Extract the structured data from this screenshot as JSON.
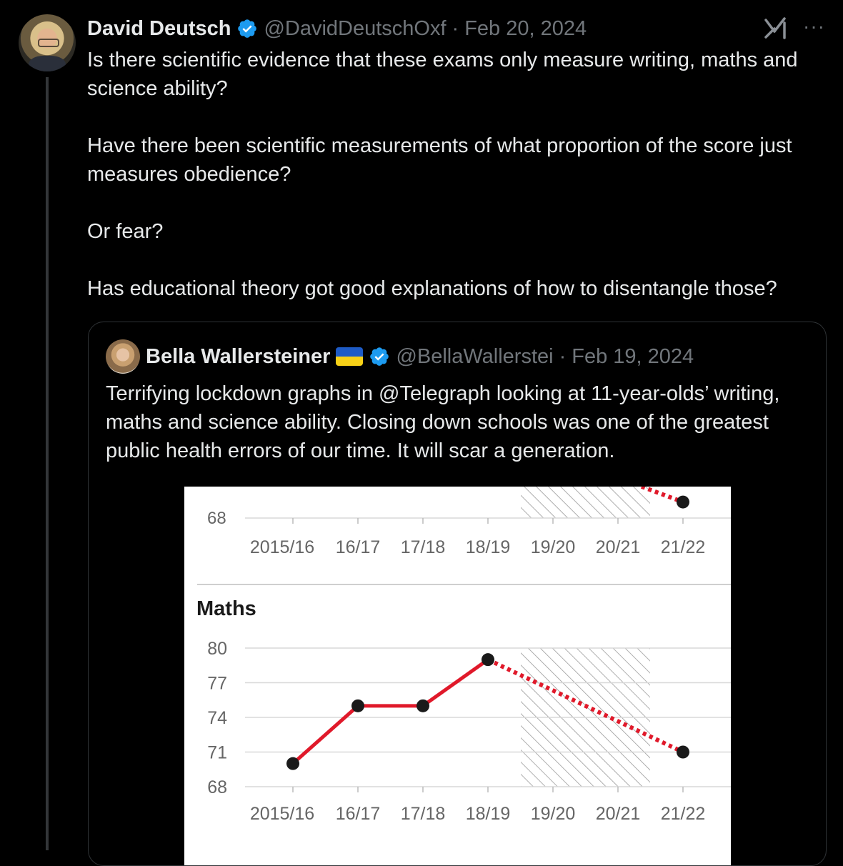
{
  "post": {
    "author_name": "David Deutsch",
    "handle": "@DavidDeutschOxf",
    "separator": "·",
    "date": "Feb 20, 2024",
    "more_label": "···",
    "paragraphs": [
      "Is there scientific evidence that these exams only measure writing, maths and science ability?",
      "Have there been scientific measurements of what proportion of the score just measures obedience?",
      "Or fear?",
      "Has educational theory got good explanations of how to disentangle those?"
    ]
  },
  "quote": {
    "author_name": "Bella Wallersteiner",
    "handle": "@BellaWallerstei",
    "separator": "·",
    "date": "Feb 19, 2024",
    "text": "Terrifying lockdown graphs in @Telegraph looking at 11-year-olds’ writing, maths and science ability. Closing down schools was one of the greatest public health errors of our time. It will scar a generation."
  },
  "colors": {
    "background": "#000000",
    "text": "#e7e9ea",
    "muted": "#71767b",
    "verified": "#1d9bf0",
    "line": "#e0192a",
    "point": "#1a1a1a"
  },
  "icons": [
    "verified-badge-icon",
    "grok-icon",
    "more-icon",
    "ukraine-flag-icon"
  ],
  "chart_data": [
    {
      "type": "line",
      "title": "",
      "partially_visible": true,
      "categories": [
        "2015/16",
        "16/17",
        "17/18",
        "18/19",
        "19/20",
        "20/21",
        "21/22"
      ],
      "visible_y_ticks": [
        "68"
      ],
      "points": [
        {
          "x": "21/22",
          "y": 69.4
        }
      ],
      "dotted_segment": {
        "from": "20/21",
        "to": "21/22"
      },
      "hatched_range": [
        "19/20",
        "20/21"
      ]
    },
    {
      "type": "line",
      "title": "Maths",
      "categories": [
        "2015/16",
        "16/17",
        "17/18",
        "18/19",
        "19/20",
        "20/21",
        "21/22"
      ],
      "y_ticks": [
        "80",
        "77",
        "74",
        "71",
        "68"
      ],
      "ylim": [
        68,
        80
      ],
      "series": [
        {
          "points": [
            {
              "x": "2015/16",
              "y": 70
            },
            {
              "x": "16/17",
              "y": 75
            },
            {
              "x": "17/18",
              "y": 75
            },
            {
              "x": "18/19",
              "y": 79
            },
            {
              "x": "21/22",
              "y": 71
            }
          ]
        }
      ],
      "solid_segments": [
        [
          "2015/16",
          "16/17"
        ],
        [
          "16/17",
          "17/18"
        ],
        [
          "17/18",
          "18/19"
        ]
      ],
      "dotted_segments": [
        [
          "18/19",
          "21/22"
        ]
      ],
      "hatched_range": [
        "19/20",
        "20/21"
      ],
      "grid": true
    }
  ]
}
